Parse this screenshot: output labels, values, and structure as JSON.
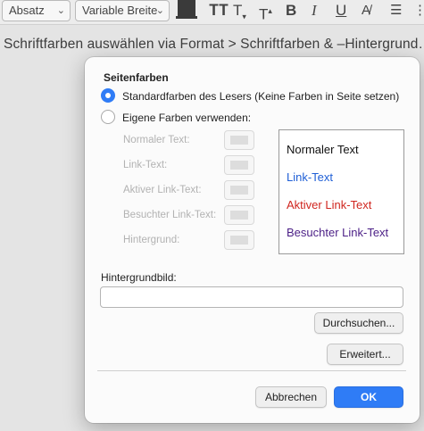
{
  "toolbar": {
    "paragraph_style": "Absatz",
    "width_mode": "Variable Breite"
  },
  "document": {
    "line": "Schriftfarben auswählen via Format > Schriftfarben & –Hintergrund…."
  },
  "dialog": {
    "section_title": "Seitenfarben",
    "option_default": "Standardfarben des Lesers (Keine Farben in Seite setzen)",
    "option_custom": "Eigene Farben verwenden:",
    "selected_option": "default",
    "fields": [
      {
        "label": "Normaler Text:"
      },
      {
        "label": "Link-Text:"
      },
      {
        "label": "Aktiver Link-Text:"
      },
      {
        "label": "Besuchter Link-Text:"
      },
      {
        "label": "Hintergrund:"
      }
    ],
    "preview": [
      {
        "text": "Normaler Text",
        "color": "#111111"
      },
      {
        "text": "Link-Text",
        "color": "#1f5fd6"
      },
      {
        "text": "Aktiver Link-Text",
        "color": "#d0261f"
      },
      {
        "text": "Besuchter Link-Text",
        "color": "#4b1f86"
      }
    ],
    "background_image_label": "Hintergrundbild:",
    "background_image_value": "",
    "browse_button": "Durchsuchen...",
    "advanced_button": "Erweitert...",
    "cancel_button": "Abbrechen",
    "ok_button": "OK"
  },
  "colors": {
    "accent": "#2f7cf6"
  }
}
